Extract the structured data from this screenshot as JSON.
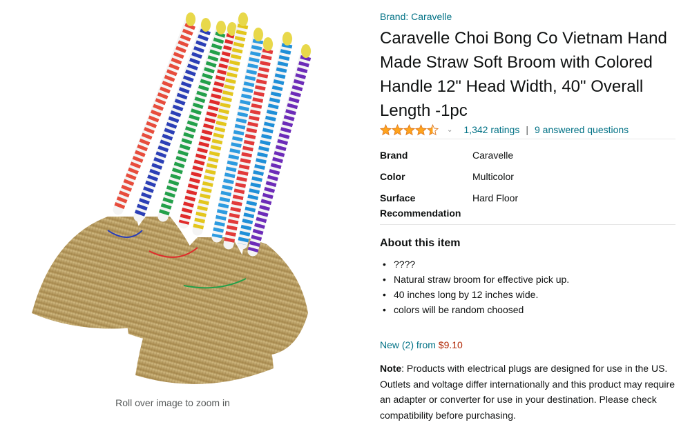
{
  "image": {
    "zoom_hint": "Roll over image to zoom in",
    "handle_colors": [
      "#e74c3c",
      "#2b3fb6",
      "#23a04a",
      "#e02b2b",
      "#e3c61d",
      "#2d9be0",
      "#e23a3a",
      "#1f8fd8",
      "#6c2bb8"
    ]
  },
  "product": {
    "brand_link": "Brand: Caravelle",
    "title": "Caravelle Choi Bong Co Vietnam Hand Made Straw Soft Broom with Colored Handle 12\" Head Width, 40\" Overall Length -1pc",
    "rating": 4.5,
    "ratings_count": "1,342 ratings",
    "separator": "|",
    "answered_questions": "9 answered questions"
  },
  "specs": [
    {
      "label": "Brand",
      "value": "Caravelle"
    },
    {
      "label": "Color",
      "value": "Multicolor"
    },
    {
      "label": "Surface Recommendation",
      "value": "Hard Floor"
    }
  ],
  "about": {
    "title": "About this item",
    "bullets": [
      "????",
      "Natural straw broom for effective pick up.",
      "40 inches long by 12 inches wide.",
      "colors will be random choosed"
    ]
  },
  "offers": {
    "new_label": "New (2) from",
    "price": "$9.10"
  },
  "note": {
    "label": "Note",
    "text": ": Products with electrical plugs are designed for use in the US. Outlets and voltage differ internationally and this product may require an adapter or converter for use in your destination. Please check compatibility before purchasing."
  },
  "colors": {
    "link": "#007185",
    "price": "#b12704",
    "star": "#ffa41c",
    "text": "#0f1111"
  }
}
